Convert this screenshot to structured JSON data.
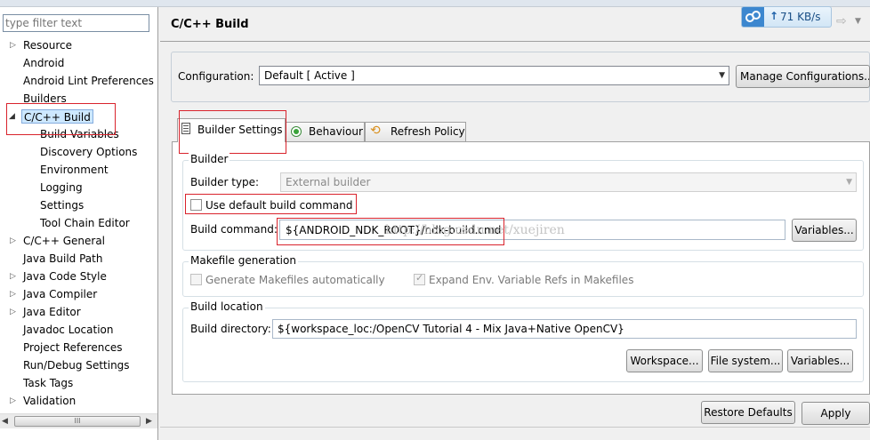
{
  "sidebar": {
    "filter_placeholder": "type filter text",
    "items": [
      {
        "label": "Resource",
        "arrow": "▷"
      },
      {
        "label": "Android",
        "arrow": ""
      },
      {
        "label": "Android Lint Preferences",
        "arrow": ""
      },
      {
        "label": "Builders",
        "arrow": ""
      },
      {
        "label": "C/C++ Build",
        "arrow": "◢"
      },
      {
        "label": "Build Variables",
        "arrow": ""
      },
      {
        "label": "Discovery Options",
        "arrow": ""
      },
      {
        "label": "Environment",
        "arrow": ""
      },
      {
        "label": "Logging",
        "arrow": ""
      },
      {
        "label": "Settings",
        "arrow": ""
      },
      {
        "label": "Tool Chain Editor",
        "arrow": ""
      },
      {
        "label": "C/C++ General",
        "arrow": "▷"
      },
      {
        "label": "Java Build Path",
        "arrow": ""
      },
      {
        "label": "Java Code Style",
        "arrow": "▷"
      },
      {
        "label": "Java Compiler",
        "arrow": "▷"
      },
      {
        "label": "Java Editor",
        "arrow": "▷"
      },
      {
        "label": "Javadoc Location",
        "arrow": ""
      },
      {
        "label": "Project References",
        "arrow": ""
      },
      {
        "label": "Run/Debug Settings",
        "arrow": ""
      },
      {
        "label": "Task Tags",
        "arrow": ""
      },
      {
        "label": "Validation",
        "arrow": "▷"
      }
    ],
    "scroll_grip": "III"
  },
  "header": {
    "title": "C/C++ Build",
    "network_speed": "71 KB/s",
    "speed_arrow": "↑"
  },
  "config": {
    "label": "Configuration:",
    "value": "Default  [ Active ]",
    "manage_button": "Manage Configurations..."
  },
  "tabs": [
    {
      "label": "Builder Settings",
      "icon": "document-icon"
    },
    {
      "label": "Behaviour",
      "icon": "radio-icon"
    },
    {
      "label": "Refresh Policy",
      "icon": "refresh-icon"
    }
  ],
  "builder": {
    "group_title": "Builder",
    "type_label": "Builder type:",
    "type_value": "External builder",
    "use_default_label": "Use default build command",
    "command_label": "Build command:",
    "command_value": "${ANDROID_NDK_ROOT}/ndk-build.cmd",
    "watermark": "http://blog.csdn.net/xuejiren",
    "variables_button": "Variables..."
  },
  "makefile": {
    "group_title": "Makefile generation",
    "generate_label": "Generate Makefiles automatically",
    "expand_label": "Expand Env. Variable Refs in Makefiles"
  },
  "location": {
    "group_title": "Build location",
    "dir_label": "Build directory:",
    "dir_value": "${workspace_loc:/OpenCV Tutorial 4 - Mix Java+Native OpenCV}",
    "workspace_button": "Workspace...",
    "filesystem_button": "File system...",
    "variables_button": "Variables..."
  },
  "footer": {
    "restore_button": "Restore Defaults",
    "apply_button": "Apply"
  }
}
